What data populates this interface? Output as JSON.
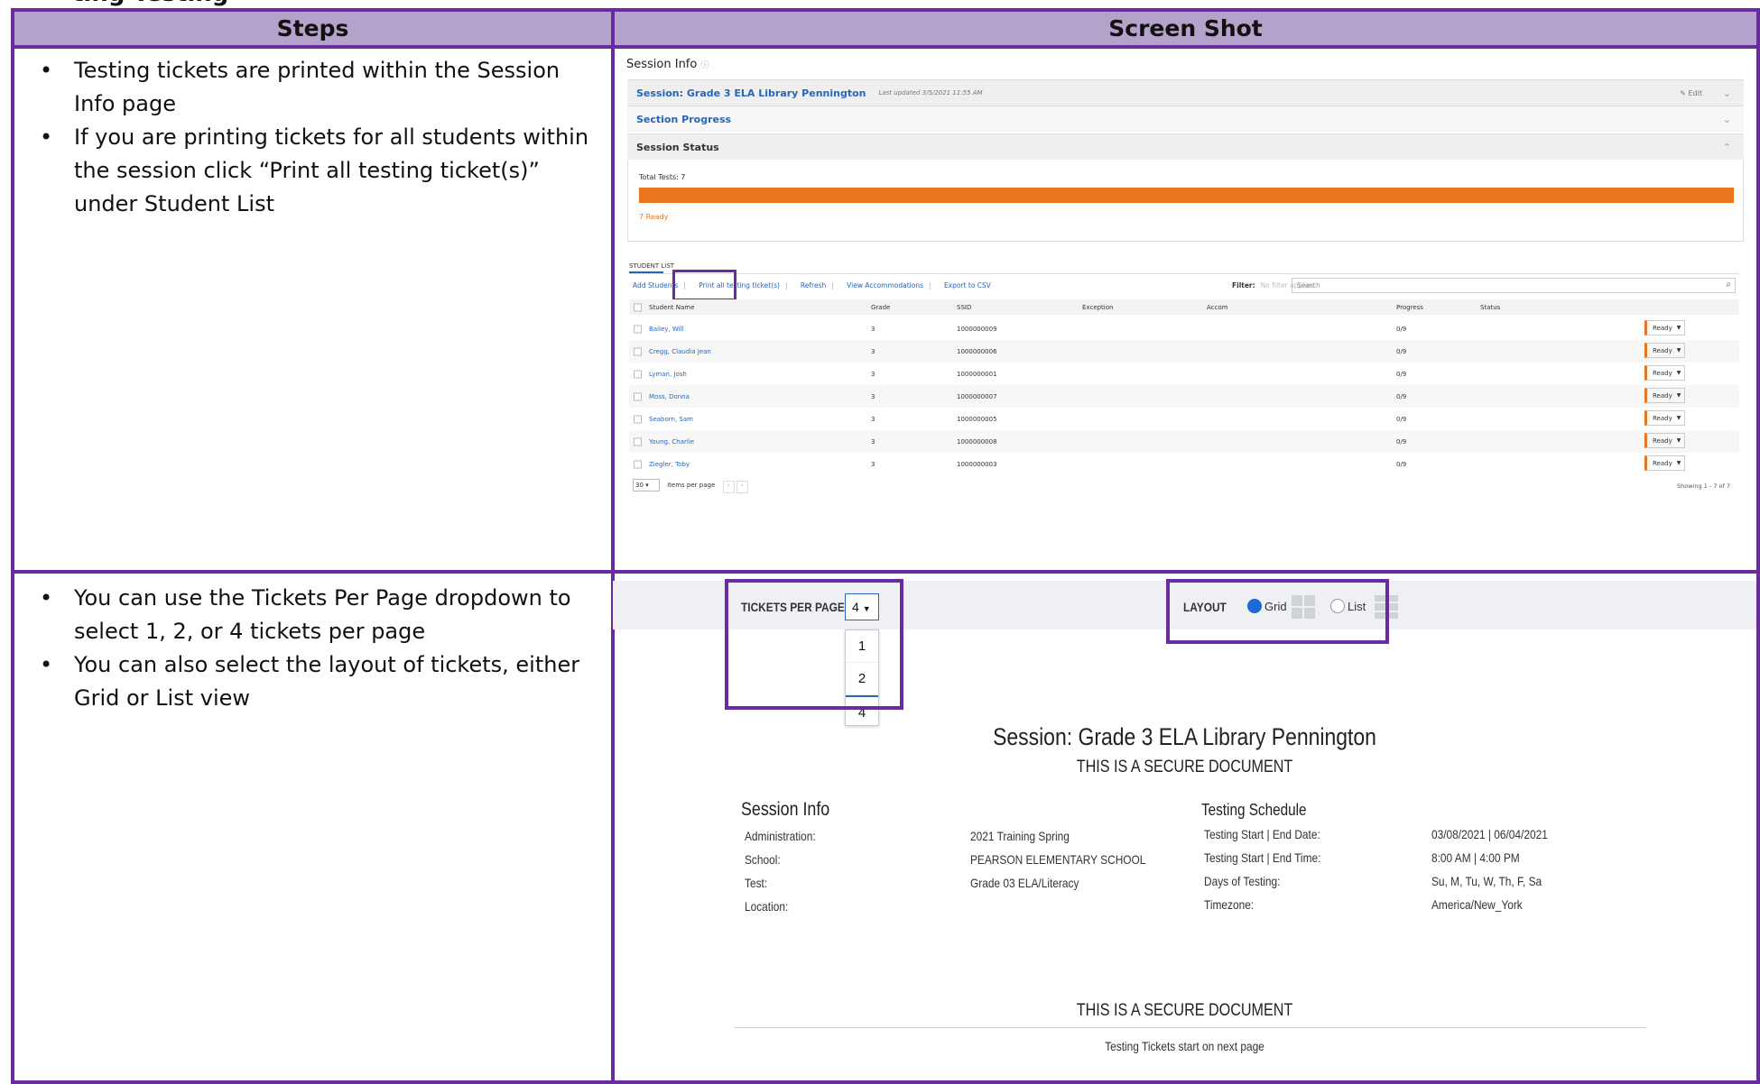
{
  "top_heading_fragment": "ting Testing",
  "table": {
    "headers": [
      "Steps",
      "Screen Shot"
    ],
    "rows": [
      {
        "steps": [
          "Testing tickets are printed within the Session Info page",
          "If you are printing tickets for all students within the session click “Print all testing ticket(s)” under Student List"
        ]
      },
      {
        "steps": [
          "You can use the Tickets Per Page dropdown to select 1, 2, or 4 tickets per page",
          "You can also select the layout of tickets, either Grid or List view"
        ]
      }
    ]
  },
  "shot1": {
    "page_title": "Session Info",
    "session_bar": {
      "label": "Session: Grade 3 ELA Library Pennington",
      "updated": "Last updated 3/5/2021 11:55 AM",
      "edit": "Edit"
    },
    "section_progress": "Section Progress",
    "session_status": "Session Status",
    "total_tests": "Total Tests: 7",
    "progress_fraction": 1.0,
    "ready_count": "7 Ready",
    "student_list_tab": "STUDENT LIST",
    "toolbar": [
      "Add Students",
      "Print all testing ticket(s)",
      "Refresh",
      "View Accommodations",
      "Export to CSV"
    ],
    "filter_label": "Filter:",
    "filter_value": "No filter applied",
    "search_placeholder": "Search",
    "columns": [
      "Student Name",
      "Grade",
      "SSID",
      "Exception",
      "Accom",
      "Progress",
      "Status"
    ],
    "students": [
      {
        "name": "Bailey, Will",
        "grade": "3",
        "ssid": "1000000009",
        "progress": "0/9",
        "status": "Ready"
      },
      {
        "name": "Cregg, Claudia Jean",
        "grade": "3",
        "ssid": "1000000006",
        "progress": "0/9",
        "status": "Ready"
      },
      {
        "name": "Lyman, Josh",
        "grade": "3",
        "ssid": "1000000001",
        "progress": "0/9",
        "status": "Ready"
      },
      {
        "name": "Moss, Donna",
        "grade": "3",
        "ssid": "1000000007",
        "progress": "0/9",
        "status": "Ready"
      },
      {
        "name": "Seaborn, Sam",
        "grade": "3",
        "ssid": "1000000005",
        "progress": "0/9",
        "status": "Ready"
      },
      {
        "name": "Young, Charlie",
        "grade": "3",
        "ssid": "1000000008",
        "progress": "0/9",
        "status": "Ready"
      },
      {
        "name": "Ziegler, Toby",
        "grade": "3",
        "ssid": "1000000003",
        "progress": "0/9",
        "status": "Ready"
      }
    ],
    "per_page_value": "30",
    "per_page_label": "items per page",
    "showing": "Showing 1 - 7 of 7"
  },
  "shot2": {
    "tickets_per_page_label": "TICKETS PER PAGE",
    "tickets_per_page_value": "4",
    "tickets_options": [
      "1",
      "2",
      "4"
    ],
    "layout_label": "LAYOUT",
    "layout_options": [
      "Grid",
      "List"
    ],
    "layout_selected": "Grid",
    "session_title": "Session: Grade 3 ELA Library Pennington",
    "secure_notice": "THIS IS A SECURE DOCUMENT",
    "session_info_heading": "Session Info",
    "testing_schedule_heading": "Testing Schedule",
    "info": [
      {
        "label": "Administration:",
        "value": "2021 Training Spring"
      },
      {
        "label": "School:",
        "value": "PEARSON ELEMENTARY SCHOOL"
      },
      {
        "label": "Test:",
        "value": "Grade 03 ELA/Literacy"
      },
      {
        "label": "Location:",
        "value": ""
      }
    ],
    "schedule": [
      {
        "label": "Testing Start | End Date:",
        "value": "03/08/2021 | 06/04/2021"
      },
      {
        "label": "Testing Start | End Time:",
        "value": "8:00 AM | 4:00 PM"
      },
      {
        "label": "Days of Testing:",
        "value": "Su, M, Tu, W, Th, F, Sa"
      },
      {
        "label": "Timezone:",
        "value": "America/New_York"
      }
    ],
    "footer_note": "Testing Tickets start on next page"
  },
  "colors": {
    "frame": "#6a2aa0",
    "header_bg": "#b3a2c9",
    "accent_blue": "#2866b8",
    "status_orange": "#e9761f"
  }
}
